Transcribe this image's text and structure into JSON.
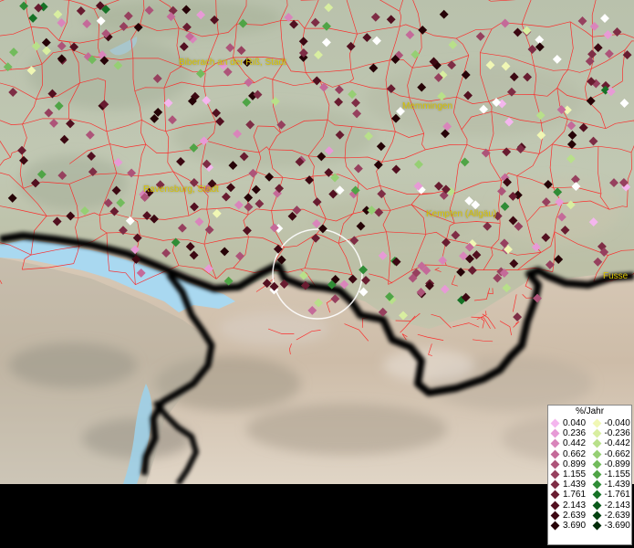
{
  "map": {
    "cities": [
      {
        "name": "Biberach an der Riß, Stadt",
        "id": "city-biberach"
      },
      {
        "name": "Memmingen",
        "id": "city-memmingen"
      },
      {
        "name": "Ravensburg, Stadt",
        "id": "city-ravensburg"
      },
      {
        "name": "Kempten (Allgäu)",
        "id": "city-kempten"
      },
      {
        "name": "Fusse",
        "id": "city-fuessen"
      }
    ],
    "colors": {
      "district_border": "#ff2020",
      "lake": "#a9d8f0",
      "country_border": "#000000",
      "highlight_circle": "#ffffff"
    }
  },
  "legend": {
    "title": "%/Jahr",
    "positive": [
      {
        "label": "0.040",
        "color": "#f4b6ee"
      },
      {
        "label": "0.236",
        "color": "#e79ad6"
      },
      {
        "label": "0.442",
        "color": "#d985bb"
      },
      {
        "label": "0.662",
        "color": "#c46a99"
      },
      {
        "label": "0.899",
        "color": "#ad5479"
      },
      {
        "label": "1.155",
        "color": "#96405e"
      },
      {
        "label": "1.439",
        "color": "#7e2d45"
      },
      {
        "label": "1.761",
        "color": "#681c30"
      },
      {
        "label": "2.143",
        "color": "#521020"
      },
      {
        "label": "2.639",
        "color": "#3c0812"
      },
      {
        "label": "3.690",
        "color": "#260307"
      }
    ],
    "negative": [
      {
        "label": "-0.040",
        "color": "#f0f7b4"
      },
      {
        "label": "-0.236",
        "color": "#d8eea0"
      },
      {
        "label": "-0.442",
        "color": "#b8e08a"
      },
      {
        "label": "-0.662",
        "color": "#96cf74"
      },
      {
        "label": "-0.899",
        "color": "#72bb5c"
      },
      {
        "label": "-1.155",
        "color": "#4fa446"
      },
      {
        "label": "-1.439",
        "color": "#2f8c36"
      },
      {
        "label": "-1.761",
        "color": "#167226"
      },
      {
        "label": "-2.143",
        "color": "#0a5a1a"
      },
      {
        "label": "-2.639",
        "color": "#054211"
      },
      {
        "label": "-3.690",
        "color": "#022b09"
      }
    ]
  }
}
